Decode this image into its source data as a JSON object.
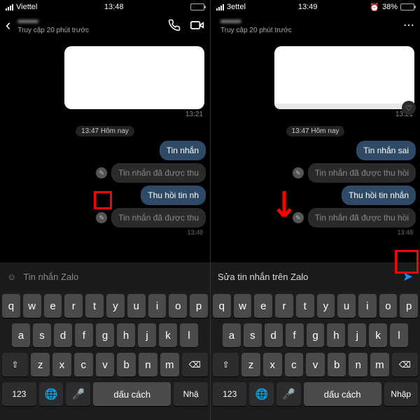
{
  "left": {
    "status": {
      "carrier": "Viettel",
      "time": "13:48",
      "batteryText": "",
      "batteryPct": 40
    },
    "header": {
      "name": "••••••",
      "sub": "Truy cập 20 phút trước"
    },
    "firstTs": "13:21",
    "date": "13:47 Hôm nay",
    "m1": "Tin nhắn",
    "m2": "Tin nhắn đã được thu",
    "m3": "Thu hồi tin nh",
    "m4": "Tin nhắn đã được thu",
    "m4ts": "13:48",
    "input": {
      "placeholder": "Tin nhắn Zalo"
    }
  },
  "right": {
    "status": {
      "carrier": "3ettel",
      "time": "13:49",
      "batteryText": "38%",
      "batteryPct": 38
    },
    "header": {
      "name": "••••••",
      "sub": "Truy cập 20 phút trước"
    },
    "firstTs": "13:21",
    "date": "13:47 Hôm nay",
    "m1": "Tin nhắn sai",
    "m2": "Tin nhắn đã được thu hồi",
    "m3": "Thu hồi tin nhắn",
    "m4": "Tin nhắn đã được thu hồi",
    "m4ts": "13:48",
    "input": {
      "text": "Sửa tin nhắn trên Zalo"
    }
  },
  "keys": {
    "r1": [
      "q",
      "w",
      "e",
      "r",
      "t",
      "y",
      "u",
      "i",
      "o",
      "p"
    ],
    "r2": [
      "a",
      "s",
      "d",
      "f",
      "g",
      "h",
      "j",
      "k",
      "l"
    ],
    "r3": [
      "z",
      "x",
      "c",
      "v",
      "b",
      "n",
      "m"
    ],
    "shift": "⇧",
    "bksp": "⌫",
    "num": "123",
    "globe": "🌐",
    "mic": "🎤",
    "space": "dấu cách",
    "retL": "Nhậ",
    "retR": "Nhập"
  }
}
